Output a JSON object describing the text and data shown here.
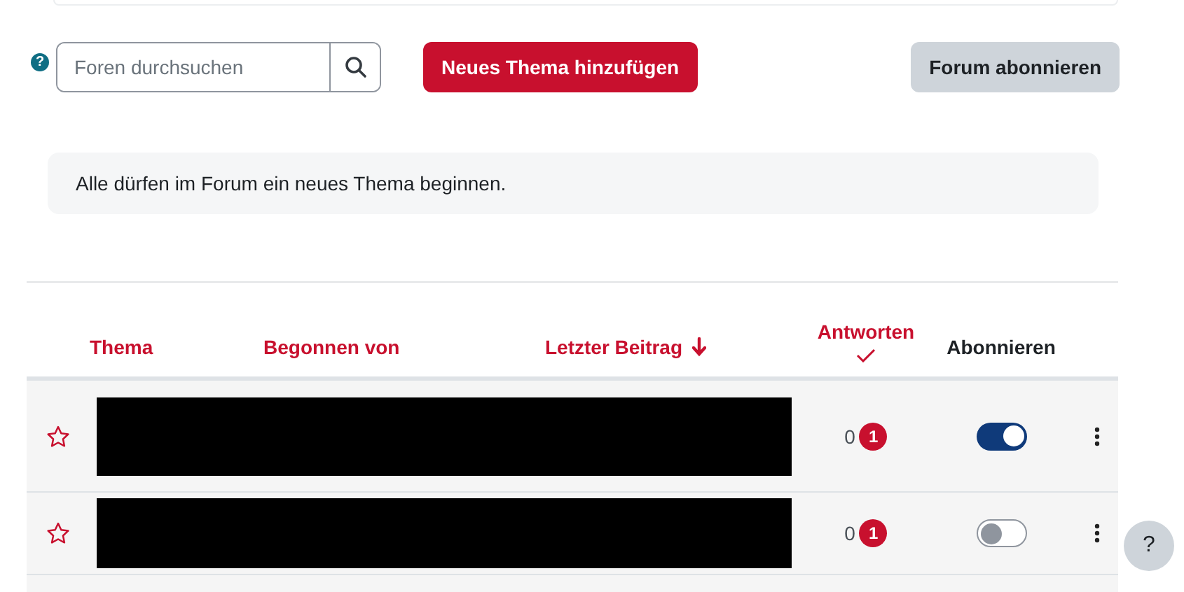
{
  "toolbar": {
    "help_badge": "?",
    "search": {
      "placeholder": "Foren durchsuchen"
    },
    "new_topic_button": "Neues Thema hinzufügen",
    "subscribe_button": "Forum abonnieren"
  },
  "notice": "Alle dürfen im Forum ein neues Thema beginnen.",
  "table": {
    "columns": [
      {
        "label": "Thema",
        "kind": "sort"
      },
      {
        "label": "Begonnen von",
        "kind": "sort"
      },
      {
        "label": "Letzter Beitrag",
        "kind": "sorted-desc"
      },
      {
        "label": "Antworten",
        "kind": "sorted-check"
      },
      {
        "label": "Abonnieren",
        "kind": "plain"
      }
    ],
    "rows": [
      {
        "starred": false,
        "replies": "0",
        "unread": "1",
        "subscribed": true,
        "redacted": true
      },
      {
        "starred": false,
        "replies": "0",
        "unread": "1",
        "subscribed": false,
        "redacted": true
      }
    ]
  },
  "help_button": "?"
}
